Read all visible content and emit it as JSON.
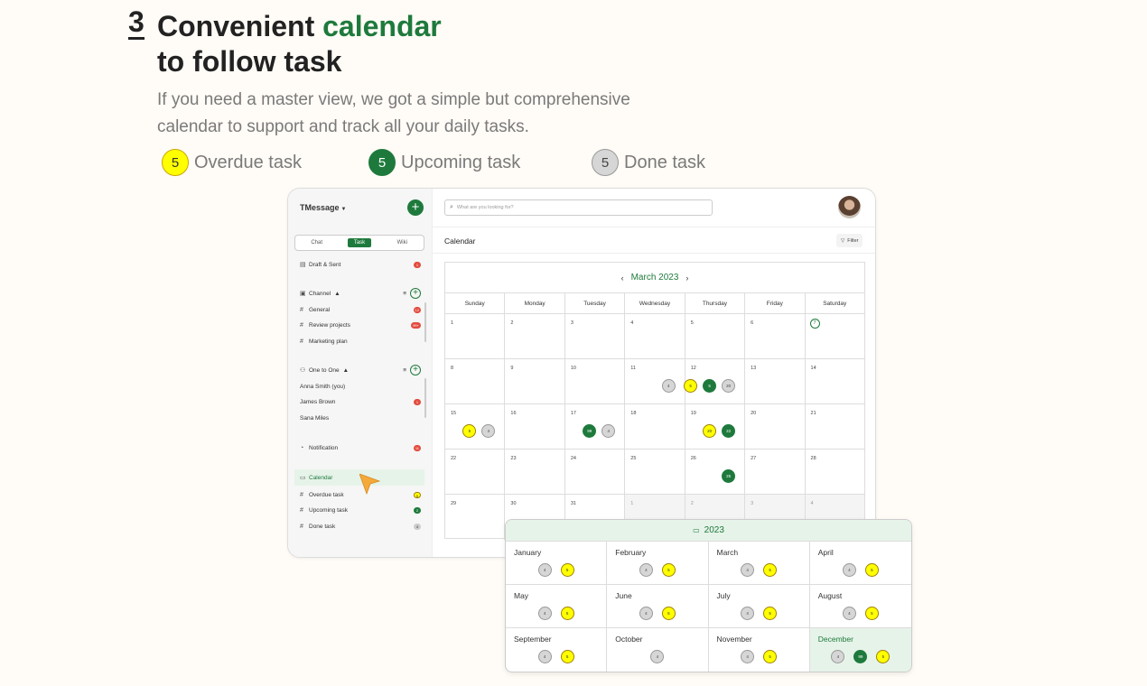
{
  "hero": {
    "step": "3",
    "title_pre": "Convenient ",
    "title_accent": "calendar",
    "title_line2": "to follow task",
    "description_line1": "If you need a master view, we got a simple but comprehensive",
    "description_line2": "calendar to support and track all your daily tasks."
  },
  "legend": [
    {
      "count": "5",
      "label": "Overdue task",
      "color": "#ffff00"
    },
    {
      "count": "5",
      "label": "Upcoming task",
      "color": "#1e7a3c"
    },
    {
      "count": "5",
      "label": "Done task",
      "color": "#d6d6d6"
    }
  ],
  "sidebar": {
    "workspace": "TMessage",
    "tabs": [
      "Chat",
      "Task",
      "Wiki"
    ],
    "draft": {
      "label": "Draft & Sent",
      "badge": "1"
    },
    "channel": {
      "label": "Channel",
      "items": [
        {
          "label": "General",
          "badge": "12"
        },
        {
          "label": "Review projects",
          "badge": "99+"
        },
        {
          "label": "Marketing plan",
          "badge": ""
        }
      ]
    },
    "one_to_one": {
      "label": "One to One",
      "items": [
        {
          "label": "Anna Smith (you)",
          "badge": ""
        },
        {
          "label": "James Brown",
          "badge": "1"
        },
        {
          "label": "Sana Miles",
          "badge": ""
        }
      ]
    },
    "notification": {
      "label": "Notification",
      "badge": "11"
    },
    "calendar": {
      "label": "Calendar"
    },
    "task_filters": [
      {
        "label": "Overdue task",
        "badge": "5"
      },
      {
        "label": "Upcoming task",
        "badge": "2"
      },
      {
        "label": "Done task",
        "badge": "4"
      }
    ]
  },
  "main": {
    "search_placeholder": "What are you looking for?",
    "title": "Calendar",
    "filter_label": "Filter",
    "month_label": "March 2023",
    "days_of_week": [
      "Sunday",
      "Monday",
      "Tuesday",
      "Wednesday",
      "Thursday",
      "Friday",
      "Saturday"
    ],
    "weeks": [
      [
        {
          "d": "1"
        },
        {
          "d": "2"
        },
        {
          "d": "3"
        },
        {
          "d": "4"
        },
        {
          "d": "5"
        },
        {
          "d": "6"
        },
        {
          "d": "7",
          "today": true
        }
      ],
      [
        {
          "d": "8"
        },
        {
          "d": "9"
        },
        {
          "d": "10"
        },
        {
          "d": "11",
          "marks": [
            [
              "gr",
              "4"
            ]
          ]
        },
        {
          "d": "12",
          "marks": [
            [
              "y",
              "5"
            ],
            [
              "g",
              "5"
            ],
            [
              "gr",
              "20"
            ]
          ]
        },
        {
          "d": "13"
        },
        {
          "d": "14"
        }
      ],
      [
        {
          "d": "15",
          "marks": [
            [
              "y",
              "5"
            ],
            [
              "gr",
              "4"
            ]
          ]
        },
        {
          "d": "16"
        },
        {
          "d": "17",
          "marks": [
            [
              "g",
              "99"
            ],
            [
              "gr",
              "4"
            ]
          ]
        },
        {
          "d": "18"
        },
        {
          "d": "19",
          "marks": [
            [
              "y",
              "20"
            ],
            [
              "g",
              "22"
            ]
          ]
        },
        {
          "d": "20"
        },
        {
          "d": "21"
        }
      ],
      [
        {
          "d": "22"
        },
        {
          "d": "23"
        },
        {
          "d": "24"
        },
        {
          "d": "25"
        },
        {
          "d": "26",
          "marks": [
            [
              "g",
              "25"
            ]
          ]
        },
        {
          "d": "27"
        },
        {
          "d": "28"
        }
      ],
      [
        {
          "d": "29"
        },
        {
          "d": "30"
        },
        {
          "d": "31"
        },
        {
          "d": "1",
          "other": true
        },
        {
          "d": "2",
          "other": true
        },
        {
          "d": "3",
          "other": true
        },
        {
          "d": "4",
          "other": true
        }
      ]
    ]
  },
  "year_view": {
    "title": "2023",
    "months": [
      {
        "name": "January",
        "marks": [
          [
            "gr",
            "4"
          ],
          [
            "y",
            "5"
          ]
        ]
      },
      {
        "name": "February",
        "marks": [
          [
            "gr",
            "4"
          ],
          [
            "y",
            "5"
          ]
        ]
      },
      {
        "name": "March",
        "marks": [
          [
            "gr",
            "4"
          ],
          [
            "y",
            "5"
          ]
        ]
      },
      {
        "name": "April",
        "marks": [
          [
            "gr",
            "4"
          ],
          [
            "y",
            "5"
          ]
        ]
      },
      {
        "name": "May",
        "marks": [
          [
            "gr",
            "4"
          ],
          [
            "y",
            "5"
          ]
        ]
      },
      {
        "name": "June",
        "marks": [
          [
            "gr",
            "4"
          ],
          [
            "y",
            "5"
          ]
        ]
      },
      {
        "name": "July",
        "marks": [
          [
            "gr",
            "4"
          ],
          [
            "y",
            "5"
          ]
        ]
      },
      {
        "name": "August",
        "marks": [
          [
            "gr",
            "4"
          ],
          [
            "y",
            "5"
          ]
        ]
      },
      {
        "name": "September",
        "marks": [
          [
            "gr",
            "4"
          ],
          [
            "y",
            "5"
          ]
        ]
      },
      {
        "name": "October",
        "marks": [
          [
            "gr",
            "4"
          ]
        ]
      },
      {
        "name": "November",
        "marks": [
          [
            "gr",
            "4"
          ],
          [
            "y",
            "5"
          ]
        ]
      },
      {
        "name": "December",
        "marks": [
          [
            "gr",
            "4"
          ],
          [
            "g",
            "99"
          ],
          [
            "y",
            "5"
          ]
        ],
        "current": true
      }
    ]
  }
}
